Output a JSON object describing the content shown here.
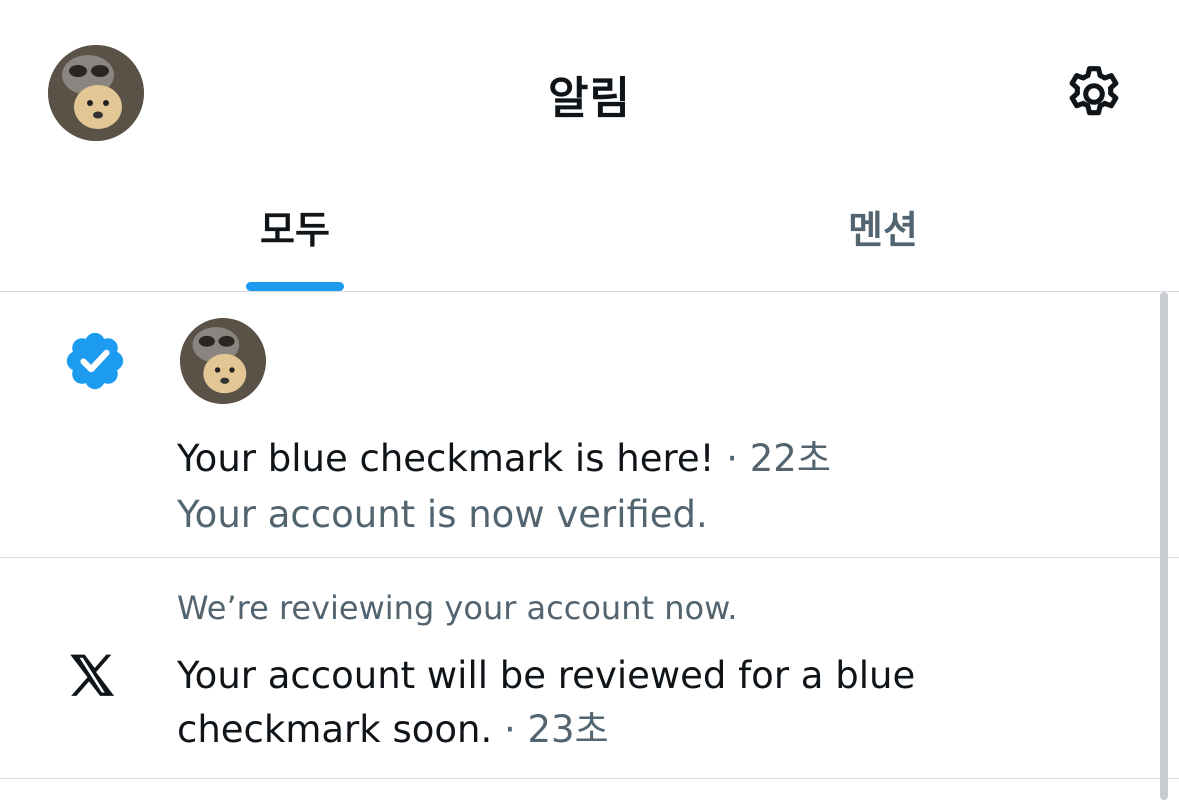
{
  "header": {
    "title": "알림"
  },
  "tabs": [
    {
      "label": "모두",
      "active": true
    },
    {
      "label": "멘션",
      "active": false
    }
  ],
  "notifications": [
    {
      "title": "Your blue checkmark is here!",
      "separator": "·",
      "time": "22초",
      "subtitle": "Your account is now verified.",
      "icon": "verified-badge-icon"
    },
    {
      "context": "We’re reviewing your account now.",
      "body_line1": "Your account will be reviewed for a blue",
      "body_line2": "checkmark soon.",
      "separator": "·",
      "time": "23초",
      "icon": "x-logo-icon"
    }
  ],
  "colors": {
    "accent": "#1d9bf0",
    "text": "#0f1419",
    "muted": "#536471",
    "divider": "#d7dbdf"
  }
}
